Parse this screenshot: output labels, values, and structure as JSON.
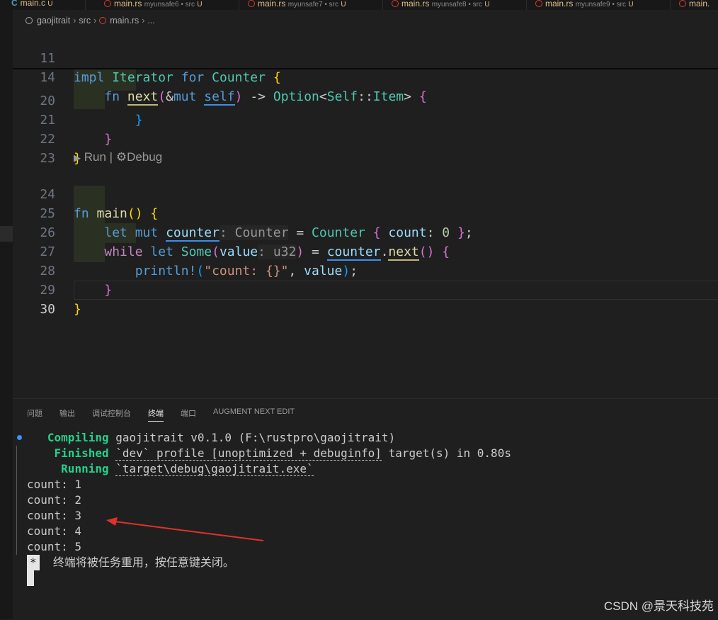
{
  "tabs": [
    {
      "name": "main.c",
      "desc": "",
      "badge": "U",
      "icon": "c-file-icon"
    },
    {
      "name": "main.rs",
      "desc": "myunsafe6 • src",
      "badge": "U",
      "icon": "rust-file-icon"
    },
    {
      "name": "main.rs",
      "desc": "myunsafe7 • src",
      "badge": "U",
      "icon": "rust-file-icon"
    },
    {
      "name": "main.rs",
      "desc": "myunsafe8 • src",
      "badge": "U",
      "icon": "rust-file-icon"
    },
    {
      "name": "main.rs",
      "desc": "myunsafe9 • src",
      "badge": "U",
      "icon": "rust-file-icon"
    },
    {
      "name": "main.",
      "desc": "",
      "badge": "",
      "icon": "rust-file-icon"
    }
  ],
  "breadcrumb": {
    "crate": "gaojitrait",
    "folder": "src",
    "file": "main.rs",
    "more": "..."
  },
  "editor": {
    "line_numbers": [
      "11",
      "14",
      "20",
      "21",
      "22",
      "23",
      "24",
      "25",
      "26",
      "27",
      "28",
      "29",
      "30"
    ],
    "codelens": {
      "run": "Run",
      "sep": "|",
      "debug": "Debug"
    },
    "hints": {
      "counter_type": ": Counter",
      "value_type": ": u32"
    },
    "tokens": {
      "impl": "impl",
      "iterator": "Iterator",
      "for": "for",
      "counter_type": "Counter",
      "fn": "fn",
      "next": "next",
      "mut": "mut",
      "self": "self",
      "option": "Option",
      "self_type": "Self",
      "item": "Item",
      "main": "main",
      "let": "let",
      "counter_var": "counter",
      "count_field": "count",
      "zero": "0",
      "while": "while",
      "some": "Some",
      "value": "value",
      "println": "println!",
      "fmt_str": "\"count: {}\""
    }
  },
  "panel": {
    "tabs": [
      "问题",
      "输出",
      "调试控制台",
      "终端",
      "端口",
      "AUGMENT NEXT EDIT"
    ],
    "active_tab": "终端",
    "terminal": {
      "compiling_label": "Compiling",
      "compiling_text": "gaojitrait v0.1.0 (F:\\rustpro\\gaojitrait)",
      "finished_label": "Finished",
      "finished_profile": "`dev` profile [unoptimized + debuginfo]",
      "finished_tail": "target(s) in 0.80s",
      "running_label": "Running",
      "running_text": "`target\\debug\\gaojitrait.exe`",
      "output_lines": [
        "count: 1",
        "count: 2",
        "count: 3",
        "count: 4",
        "count: 5"
      ],
      "reuse_marker": "*",
      "reuse_message": "终端将被任务重用，按任意键关闭。"
    }
  },
  "annotation": {
    "arrow_color": "#e0312c"
  },
  "watermark": "CSDN @景天科技苑"
}
